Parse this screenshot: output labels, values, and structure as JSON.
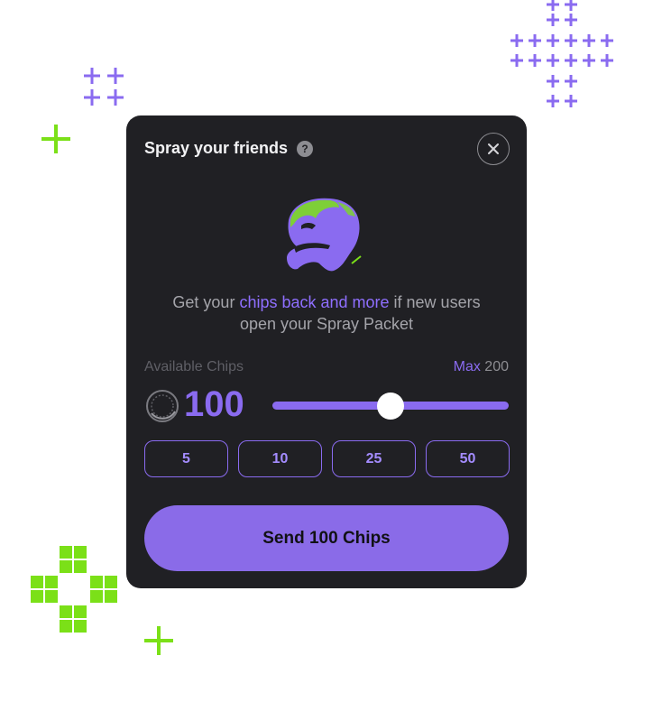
{
  "dialog": {
    "title": "Spray your friends",
    "help_icon_glyph": "?",
    "close_icon": "close-icon",
    "description_pre": "Get your ",
    "description_highlight": "chips back and more",
    "description_post": " if new users open your Spray Packet",
    "available_label": "Available Chips",
    "max_label": "Max",
    "max_value": "200",
    "amount": "100",
    "slider": {
      "min": 0,
      "max": 200,
      "value": 100
    },
    "presets": [
      "5",
      "10",
      "25",
      "50"
    ],
    "send_label": "Send 100 Chips"
  },
  "colors": {
    "accent": "#8a6bf0",
    "card_bg": "#202024",
    "lime": "#7be018",
    "button_bg": "#8a6be8"
  }
}
